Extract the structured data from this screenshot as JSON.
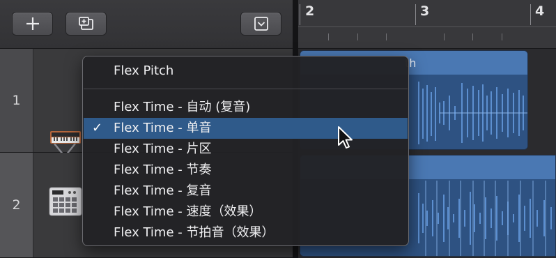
{
  "toolbar": {
    "add_icon": "plus-icon",
    "add_folder_icon": "add-track-with-settings-icon",
    "collapse_icon": "chevron-down-square-icon"
  },
  "ruler": {
    "bars": [
      "2",
      "3",
      "4"
    ]
  },
  "tracks": [
    {
      "number": "1",
      "icon": "synthesizer-keyboard-icon"
    },
    {
      "number": "2",
      "icon": "drum-machine-icon"
    }
  ],
  "regions": [
    {
      "title": "th"
    },
    {
      "title": ""
    }
  ],
  "flex_menu": {
    "header_item": "Flex Pitch",
    "items": [
      {
        "label": "Flex Time - 自动 (复音)",
        "selected": false
      },
      {
        "label": "Flex Time - 单音",
        "selected": true
      },
      {
        "label": "Flex Time - 片区",
        "selected": false
      },
      {
        "label": "Flex Time - 节奏",
        "selected": false
      },
      {
        "label": "Flex Time - 复音",
        "selected": false
      },
      {
        "label": "Flex Time - 速度（效果）",
        "selected": false
      },
      {
        "label": "Flex Time - 节拍音（效果）",
        "selected": false
      }
    ],
    "check_mark": "✓"
  },
  "colors": {
    "region_blue": "#3d6aa3",
    "selection_blue": "#2f5a8a"
  }
}
